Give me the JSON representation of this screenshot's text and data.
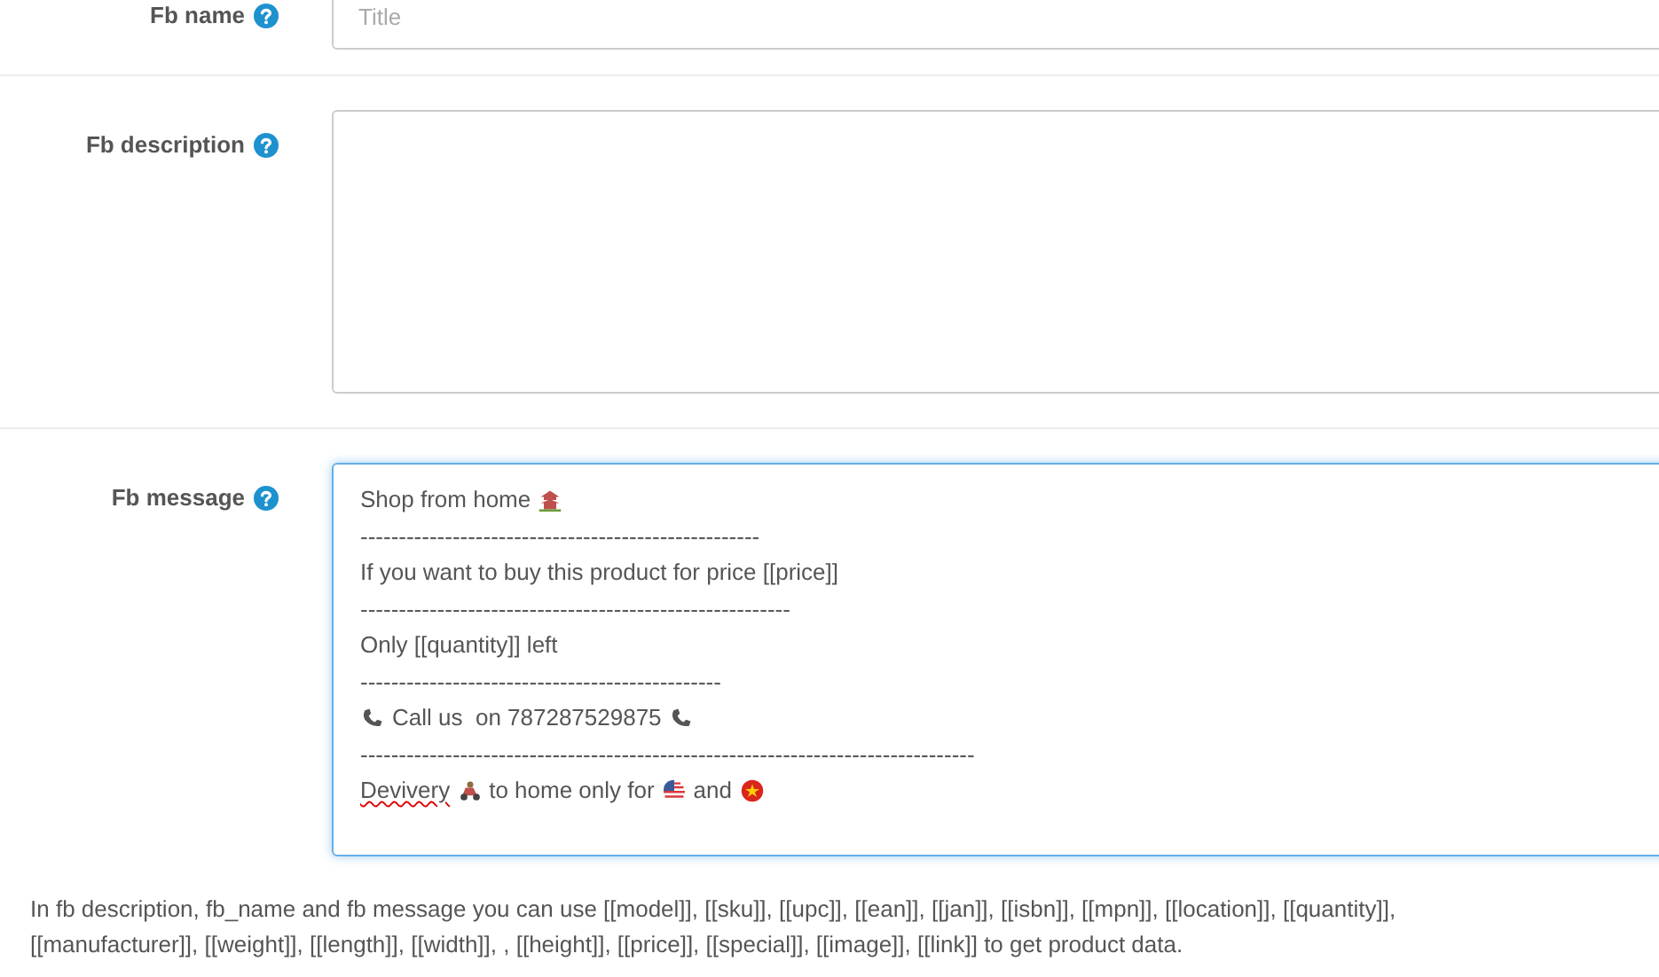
{
  "fields": [
    {
      "label": "Fb name",
      "kind": "input",
      "placeholder": "Title"
    },
    {
      "label": "Fb description",
      "kind": "textarea"
    },
    {
      "label": "Fb message",
      "kind": "message",
      "focused": true,
      "lines": [
        {
          "kind": "text",
          "segments": [
            {
              "text": "Shop from home",
              "misspelled": false
            }
          ]
        },
        {
          "kind": "rule",
          "text": "----------------------------------------------------"
        },
        {
          "kind": "text",
          "segments": [
            {
              "text": "If you want to buy this product for price [[price]]",
              "misspelled": false
            }
          ]
        },
        {
          "kind": "rule",
          "text": "--------------------------------------------------------"
        },
        {
          "kind": "text",
          "segments": [
            {
              "text": "Only [[quantity]] left",
              "misspelled": false
            }
          ]
        },
        {
          "kind": "rule",
          "text": "-----------------------------------------------"
        },
        {
          "kind": "text",
          "segments": [
            {
              "text": "Call us  on 787287529875",
              "misspelled": false
            }
          ]
        },
        {
          "kind": "rule",
          "text": "--------------------------------------------------------------------------------"
        },
        {
          "kind": "text",
          "segments": [
            {
              "text": "Devivery",
              "misspelled": true
            },
            {
              "text": "to home only for",
              "misspelled": false
            },
            {
              "text": "and",
              "misspelled": false
            }
          ]
        }
      ]
    }
  ],
  "help_text": "In fb description, fb_name and fb message you can use [[model]], [[sku]], [[upc]], [[ean]], [[jan]], [[isbn]], [[mpn]], [[location]], [[quantity]], [[manufacturer]], [[weight]], [[length]], [[width]], , [[height]], [[price]], [[special]], [[image]], [[link]] to get product data."
}
